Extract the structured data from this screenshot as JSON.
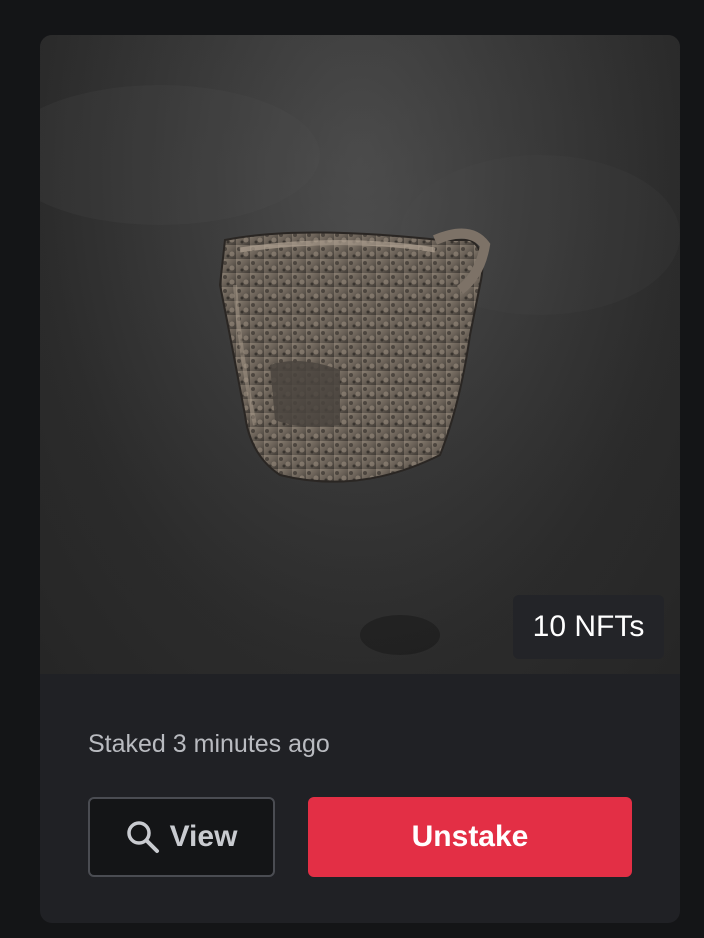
{
  "card": {
    "image_alt": "Stone cup NFT render",
    "badge_label": "10 NFTs",
    "status_text": "Staked 3 minutes ago",
    "view_label": "View",
    "view_icon": "search-icon",
    "unstake_label": "Unstake",
    "colors": {
      "background": "#141517",
      "card": "#202125",
      "unstake": "#e32f45",
      "badge": "#232428"
    }
  }
}
